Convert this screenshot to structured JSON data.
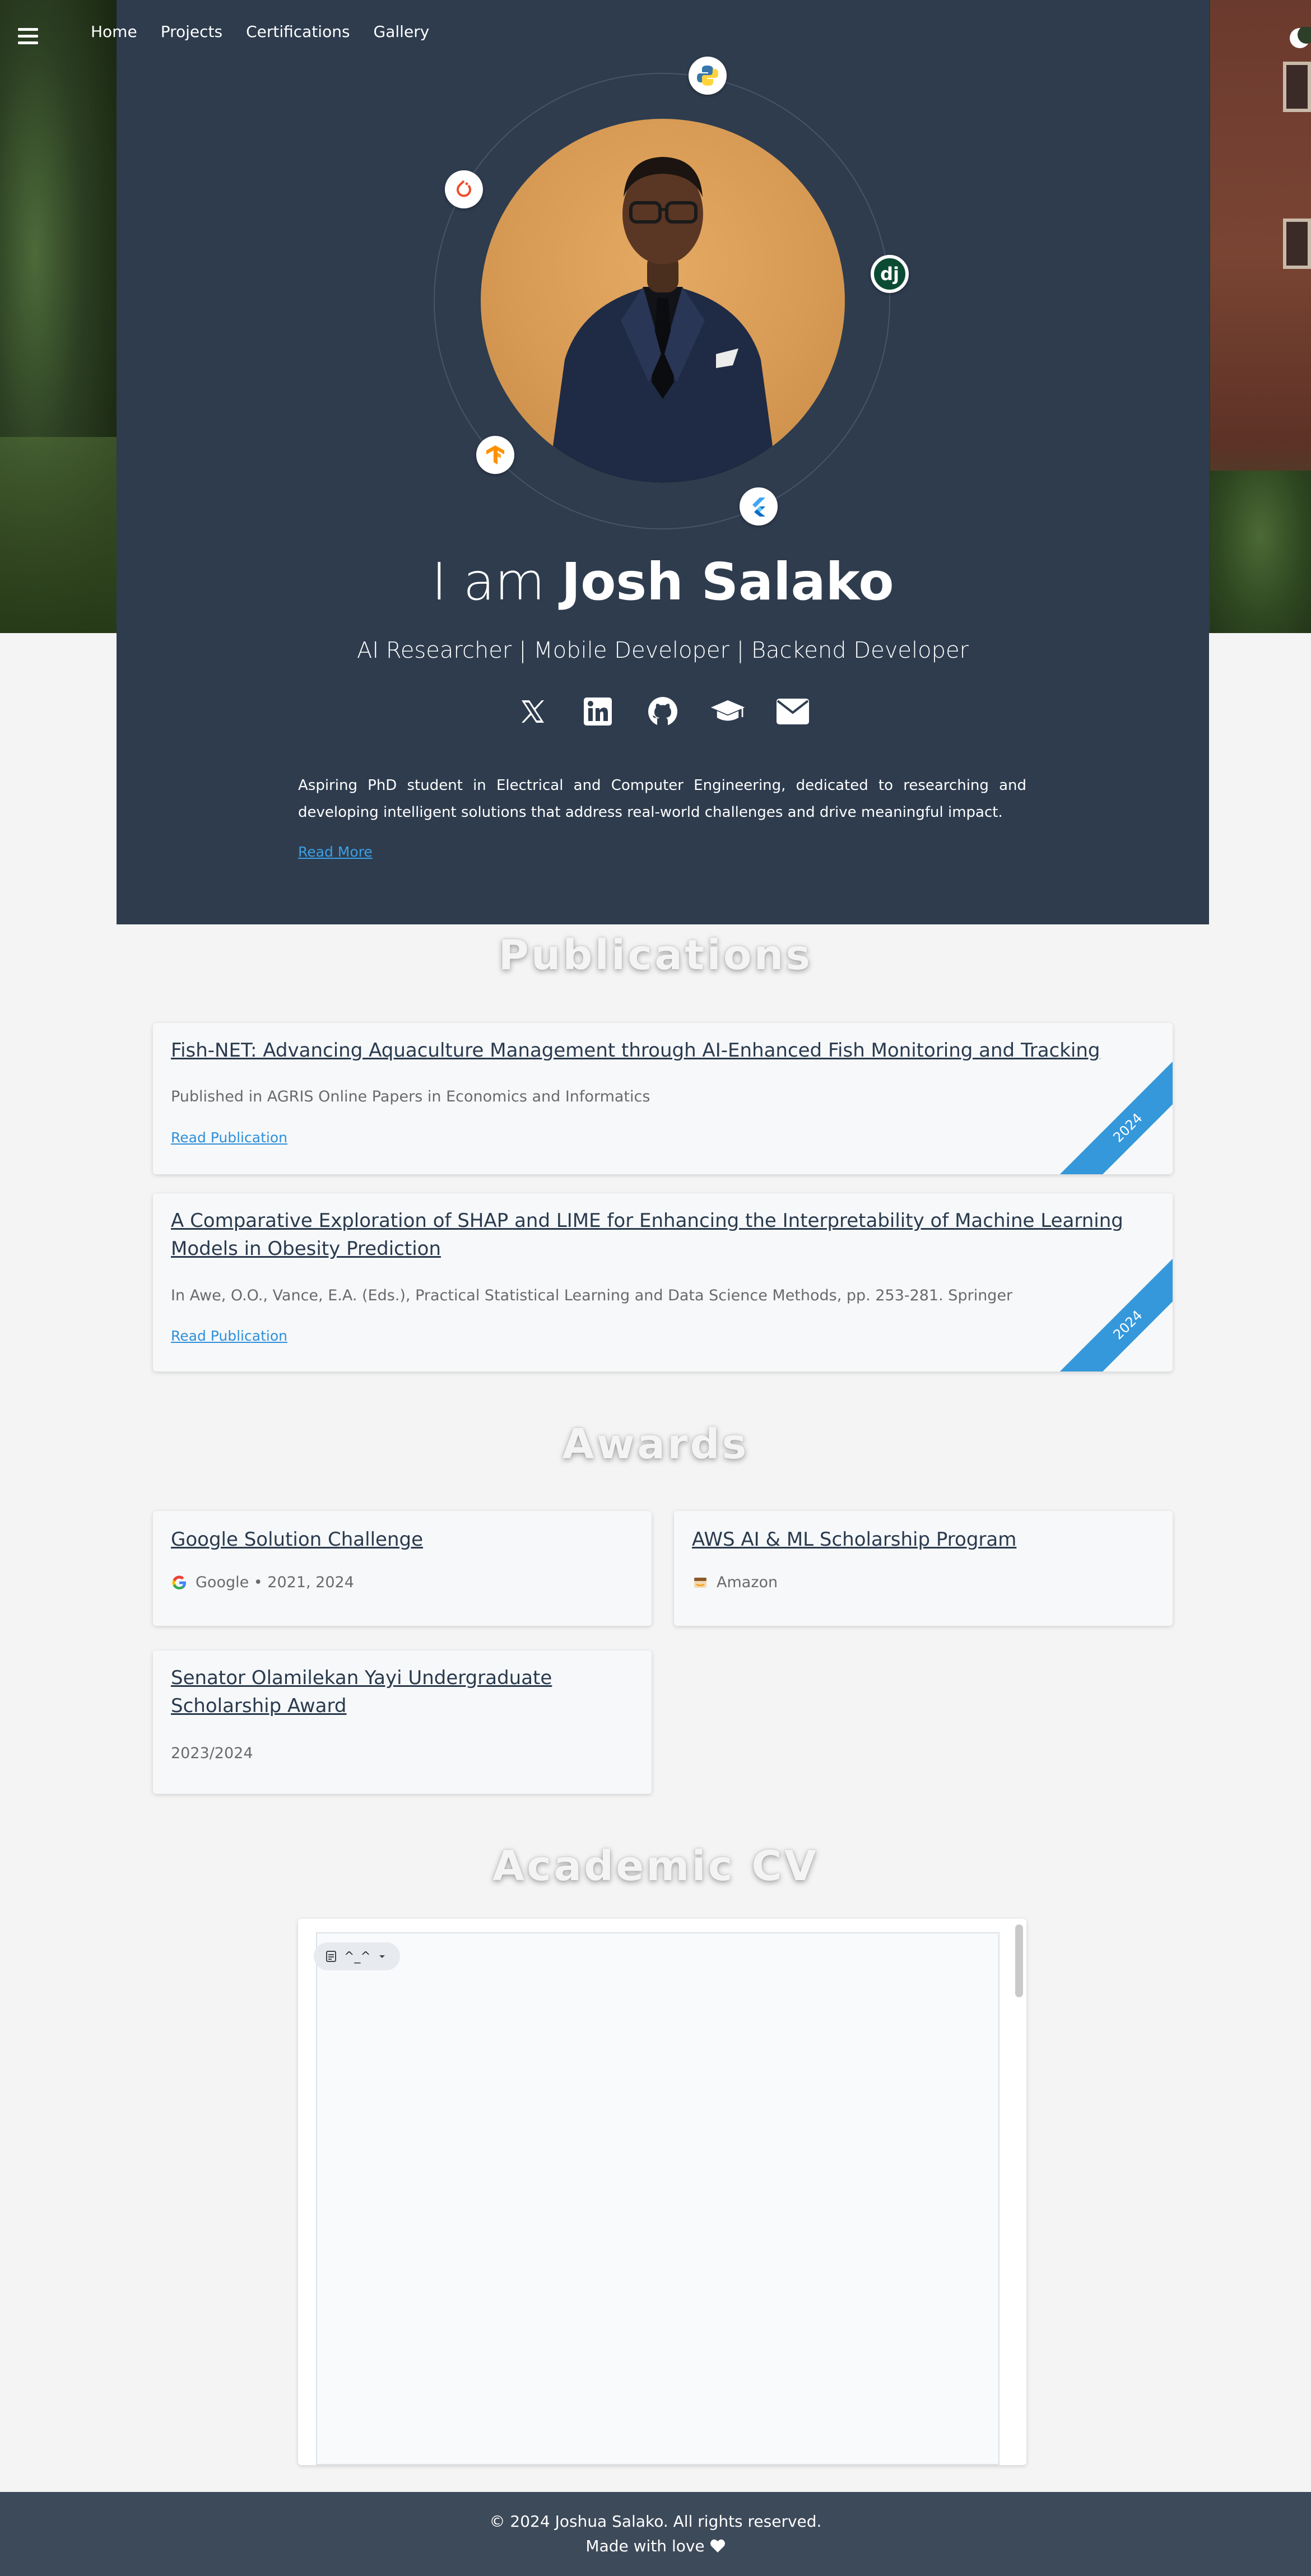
{
  "nav": {
    "items": [
      "Home",
      "Projects",
      "Certifications",
      "Gallery"
    ]
  },
  "hero": {
    "title_prefix": "I am",
    "title_name": "Josh Salako",
    "subtitle": "AI Researcher | Mobile Developer | Backend Developer",
    "description": "Aspiring PhD student in Electrical and Computer Engineering, dedicated to researching and developing intelligent solutions that address real-world challenges and drive meaningful impact.",
    "read_more": "Read More",
    "socials": [
      "x-icon",
      "linkedin-icon",
      "github-icon",
      "graduation-cap-icon",
      "email-icon"
    ],
    "orbit_icons": [
      "python-icon",
      "django-icon",
      "flutter-icon",
      "tensorflow-icon",
      "pytorch-icon"
    ]
  },
  "publications": {
    "heading": "Publications",
    "items": [
      {
        "title": "Fish-NET: Advancing Aquaculture Management through AI-Enhanced Fish Monitoring and Tracking",
        "meta": "Published in AGRIS Online Papers in Economics and Informatics",
        "link": "Read Publication",
        "year": "2024"
      },
      {
        "title": "A Comparative Exploration of SHAP and LIME for Enhancing the Interpretability of Machine Learning Models in Obesity Prediction",
        "meta": "In Awe, O.O., Vance, E.A. (Eds.), Practical Statistical Learning and Data Science Methods, pp. 253-281. Springer",
        "link": "Read Publication",
        "year": "2024"
      }
    ]
  },
  "awards": {
    "heading": "Awards",
    "items": [
      {
        "title": "Google Solution Challenge",
        "meta": "Google • 2021, 2024",
        "icon": "google-icon"
      },
      {
        "title": "AWS AI & ML Scholarship Program",
        "meta": "Amazon",
        "icon": "amazon-icon"
      },
      {
        "title": "Senator Olamilekan Yayi Undergraduate Scholarship Award",
        "meta": "2023/2024"
      }
    ]
  },
  "cv": {
    "heading": "Academic CV",
    "toolbar_label": "^_^"
  },
  "footer": {
    "copyright": "© 2024 Joshua Salako. All rights reserved.",
    "made_with": "Made with love"
  },
  "colors": {
    "hero_bg": "#2e3c4e",
    "accent": "#3498db",
    "footer_bg": "#3d4a5a",
    "page_bg": "#f4f4f4"
  }
}
